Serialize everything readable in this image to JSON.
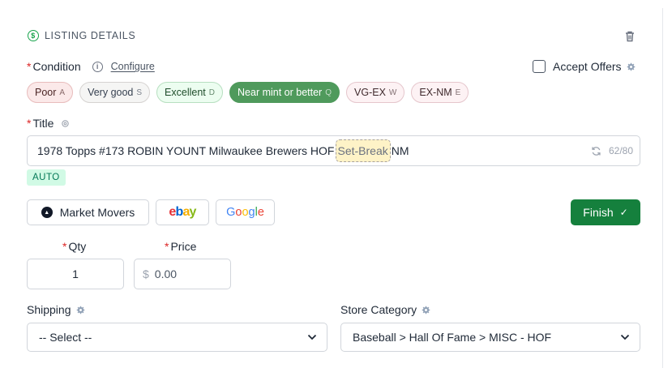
{
  "header": {
    "title": "LISTING DETAILS"
  },
  "condition": {
    "label": "Condition",
    "configure_label": "Configure",
    "options": [
      {
        "label": "Poor",
        "key": "A",
        "selected": false,
        "bg": "#fbe9e9",
        "border": "#e8bcbc",
        "color": "#4b2525"
      },
      {
        "label": "Very good",
        "key": "S",
        "selected": false,
        "bg": "#f5f5f4",
        "border": "#d6d3d1",
        "color": "#374151"
      },
      {
        "label": "Excellent",
        "key": "D",
        "selected": false,
        "bg": "#ecfdf0",
        "border": "#b7dfc0",
        "color": "#1f4d2b"
      },
      {
        "label": "Near mint or better",
        "key": "Q",
        "selected": true,
        "bg": "#4f9a5c",
        "border": "#4f9a5c",
        "color": "#ffffff"
      },
      {
        "label": "VG-EX",
        "key": "W",
        "selected": false,
        "bg": "#fdf2f4",
        "border": "#e5c6cc",
        "color": "#3f2a2d"
      },
      {
        "label": "EX-NM",
        "key": "E",
        "selected": false,
        "bg": "#fdf2f4",
        "border": "#e5c6cc",
        "color": "#3f2a2d"
      }
    ]
  },
  "accept_offers": {
    "label": "Accept Offers",
    "checked": false
  },
  "title": {
    "label": "Title",
    "value_before": "1978 Topps #173 ROBIN YOUNT Milwaukee Brewers HOF",
    "highlight": "Set-Break",
    "value_after": "NM",
    "counter": "62/80",
    "badge": "AUTO"
  },
  "search_buttons": {
    "market_movers": "Market Movers",
    "ebay": "ebay",
    "google": "Google"
  },
  "finish_label": "Finish",
  "qty": {
    "label": "Qty",
    "value": "1"
  },
  "price": {
    "label": "Price",
    "currency": "$",
    "placeholder": "0.00"
  },
  "shipping": {
    "label": "Shipping",
    "value": "-- Select --"
  },
  "store_category": {
    "label": "Store Category",
    "value": "Baseball > Hall Of Fame > MISC - HOF"
  },
  "colors": {
    "accent": "#15803d",
    "required": "#dc2626"
  }
}
